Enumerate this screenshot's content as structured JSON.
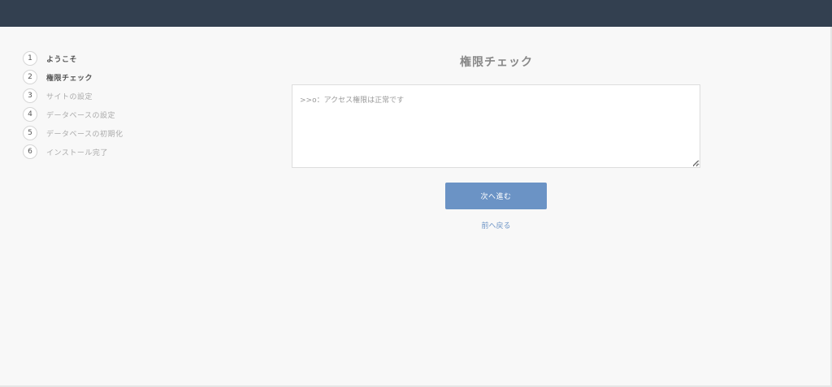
{
  "steps": [
    {
      "number": "1",
      "label": "ようこそ"
    },
    {
      "number": "2",
      "label": "権限チェック"
    },
    {
      "number": "3",
      "label": "サイトの設定"
    },
    {
      "number": "4",
      "label": "データベースの設定"
    },
    {
      "number": "5",
      "label": "データベースの初期化"
    },
    {
      "number": "6",
      "label": "インストール完了"
    }
  ],
  "main": {
    "title": "権限チェック",
    "result_text": ">>o：アクセス権限は正常です",
    "next_label": "次へ進む",
    "back_label": "前へ戻る"
  },
  "colors": {
    "topbar": "#334050",
    "accent": "#6b93c5",
    "background": "#f8f8f8"
  }
}
